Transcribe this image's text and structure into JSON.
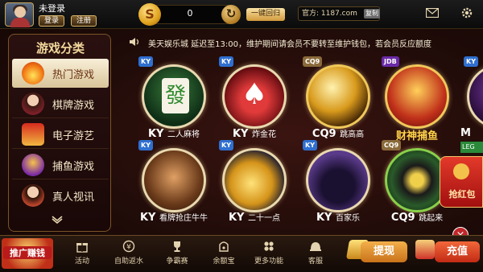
{
  "header": {
    "login_status": "未登录",
    "login_label": "登录",
    "register_label": "注册",
    "balance": "0",
    "return_label": "一键回归",
    "site_label": "官方: 1187.com",
    "copy_label": "复制"
  },
  "sidebar": {
    "title": "游戏分类",
    "items": [
      {
        "label": "热门游戏",
        "icon": "flame-icon",
        "active": true
      },
      {
        "label": "棋牌游戏",
        "icon": "dealer-icon",
        "active": false
      },
      {
        "label": "电子游艺",
        "icon": "slot-machine-icon",
        "active": false
      },
      {
        "label": "捕鱼游戏",
        "icon": "fish-icon",
        "active": false
      },
      {
        "label": "真人视讯",
        "icon": "live-dealer-icon",
        "active": false
      }
    ]
  },
  "marquee": {
    "text": "美天娱乐城 延迟至13:00，维护期间请会员不要转至维护钱包，若会员反应额度"
  },
  "games": [
    {
      "badge": "KY",
      "name": "KY",
      "sub": "二人麻将",
      "icon": "mahjong-tile-icon"
    },
    {
      "badge": "KY",
      "name": "KY",
      "sub": "炸金花",
      "icon": "poker-chips-icon"
    },
    {
      "badge": "CQ9",
      "name": "CQ9",
      "sub": "跳高高",
      "icon": "disco-ball-icon"
    },
    {
      "badge": "JDB",
      "name": "",
      "sub": "财神捕鱼",
      "icon": "fortune-god-icon"
    },
    {
      "badge": "KY",
      "name": "M",
      "sub": "",
      "icon": "partial-icon"
    },
    {
      "badge": "KY",
      "name": "KY",
      "sub": "看牌抢庄牛牛",
      "icon": "bull-icon"
    },
    {
      "badge": "KY",
      "name": "KY",
      "sub": "二十一点",
      "icon": "gold-coins-icon"
    },
    {
      "badge": "KY",
      "name": "KY",
      "sub": "百家乐",
      "icon": "magic-hat-icon"
    },
    {
      "badge": "CQ9",
      "name": "CQ9",
      "sub": "跳起来",
      "icon": "turntable-icon"
    }
  ],
  "right_promo": {
    "hongbao_label": "抢红包",
    "lec_badge": "LEG"
  },
  "bottom_nav": {
    "promo_label": "推广赚钱",
    "items": [
      {
        "label": "活动",
        "icon": "gift-icon"
      },
      {
        "label": "自助返水",
        "icon": "cashback-icon"
      },
      {
        "label": "争霸赛",
        "icon": "trophy-icon"
      },
      {
        "label": "余额宝",
        "icon": "wallet-icon"
      },
      {
        "label": "更多功能",
        "icon": "grid-icon"
      },
      {
        "label": "客服",
        "icon": "support-icon"
      }
    ],
    "withdraw_label": "提现",
    "deposit_label": "充值"
  },
  "colors": {
    "accent_gold": "#d9b56a",
    "brand_red": "#c12a14",
    "background": "#1e0b08"
  }
}
